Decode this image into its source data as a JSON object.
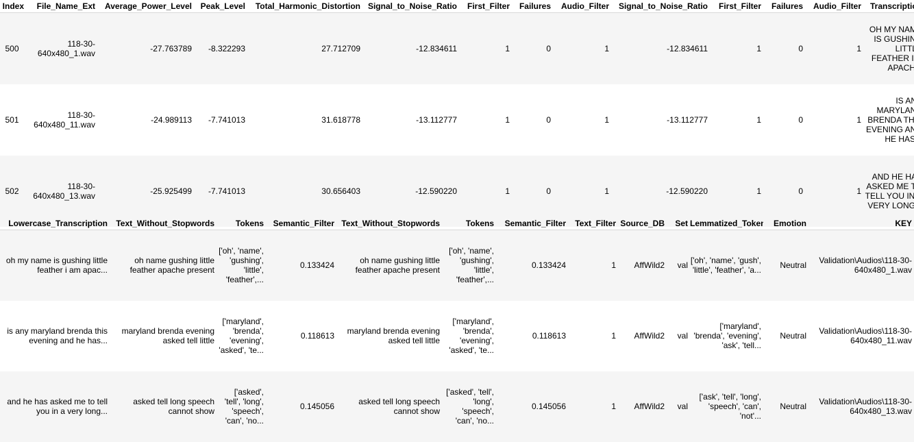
{
  "table1": {
    "headers": [
      "Index",
      "File_Name_Ext",
      "Average_Power_Level",
      "Peak_Level",
      "Total_Harmonic_Distortion",
      "Signal_to_Noise_Ratio",
      "First_Filter",
      "Failures",
      "Audio_Filter",
      "Signal_to_Noise_Ratio",
      "First_Filter",
      "Failures",
      "Audio_Filter",
      "Transcription"
    ],
    "rows": [
      [
        "500",
        "118-30-640x480_1.wav",
        "-27.763789",
        "-8.322293",
        "27.712709",
        "-12.834611",
        "1",
        "0",
        "1",
        "-12.834611",
        "1",
        "0",
        "1",
        "OH MY NAME IS GUSHING LITTLE FEATHER I'M APACH..."
      ],
      [
        "501",
        "118-30-640x480_11.wav",
        "-24.989113",
        "-7.741013",
        "31.618778",
        "-13.112777",
        "1",
        "0",
        "1",
        "-13.112777",
        "1",
        "0",
        "1",
        "IS ANY MARYLAND BRENDA THIS EVENING AND HE HAS..."
      ],
      [
        "502",
        "118-30-640x480_13.wav",
        "-25.925499",
        "-7.741013",
        "30.656403",
        "-12.590220",
        "1",
        "0",
        "1",
        "-12.590220",
        "1",
        "0",
        "1",
        "AND HE HAS ASKED ME TO TELL YOU IN A VERY LONG..."
      ]
    ]
  },
  "table2": {
    "headers": [
      "Lowercase_Transcription",
      "Text_Without_Stopwords",
      "Tokens",
      "Semantic_Filter",
      "Text_Without_Stopwords",
      "Tokens",
      "Semantic_Filter",
      "Text_Filter",
      "Source_DB",
      "Set",
      "Lemmatized_Tokens",
      "Emotion",
      "KEY"
    ],
    "rows": [
      [
        "oh my name is gushing little feather i am apac...",
        "oh name gushing little feather apache present",
        "['oh', 'name', 'gushing', 'little', 'feather',...",
        "0.133424",
        "oh name gushing little feather apache present",
        "['oh', 'name', 'gushing', 'little', 'feather',...",
        "0.133424",
        "1",
        "AffWild2",
        "val",
        "['oh', 'name', 'gush', 'little', 'feather', 'a...",
        "Neutral",
        "Validation\\Audios\\118-30-640x480_1.wav"
      ],
      [
        "is any maryland brenda this evening and he has...",
        "maryland brenda evening asked tell little",
        "['maryland', 'brenda', 'evening', 'asked', 'te...",
        "0.118613",
        "maryland brenda evening asked tell little",
        "['maryland', 'brenda', 'evening', 'asked', 'te...",
        "0.118613",
        "1",
        "AffWild2",
        "val",
        "['maryland', 'brenda', 'evening', 'ask', 'tell...",
        "Neutral",
        "Validation\\Audios\\118-30-640x480_11.wav"
      ],
      [
        "and he has asked me to tell you in a very long...",
        "asked tell long speech cannot show",
        "['asked', 'tell', 'long', 'speech', 'can', 'no...",
        "0.145056",
        "asked tell long speech cannot show",
        "['asked', 'tell', 'long', 'speech', 'can', 'no...",
        "0.145056",
        "1",
        "AffWild2",
        "val",
        "['ask', 'tell', 'long', 'speech', 'can', 'not'...",
        "Neutral",
        "Validation\\Audios\\118-30-640x480_13.wav"
      ]
    ]
  }
}
